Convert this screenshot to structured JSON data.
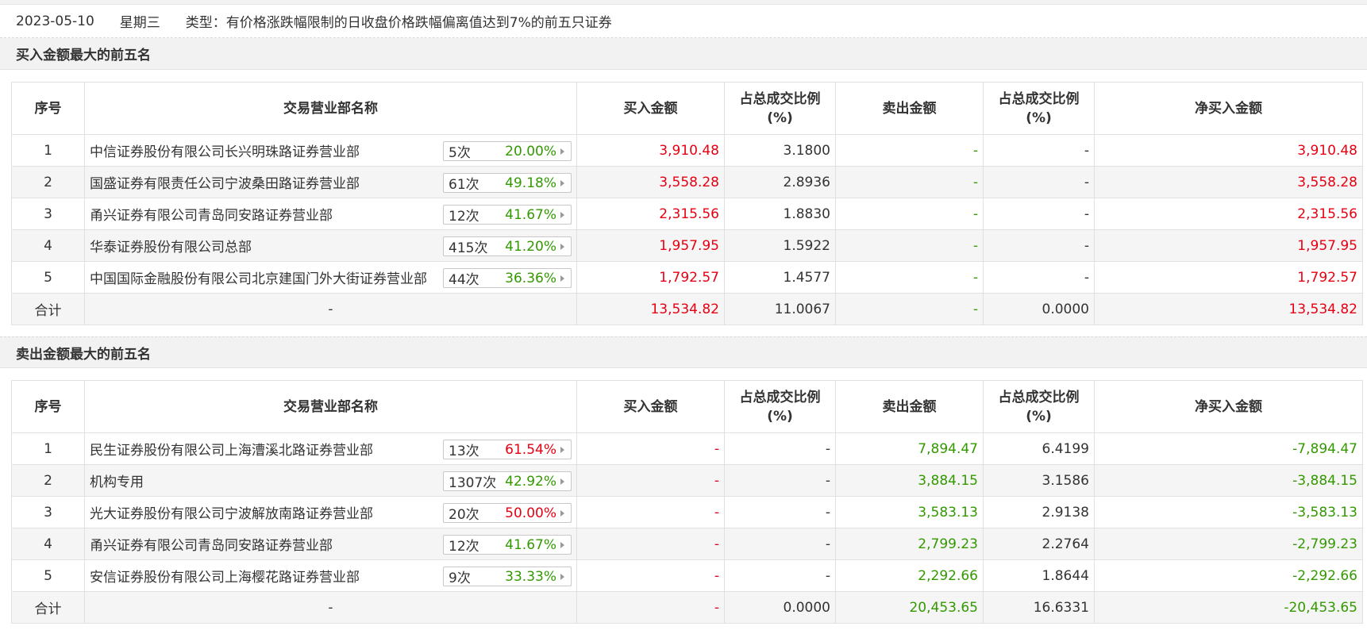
{
  "info": {
    "date": "2023-05-10",
    "weekday": "星期三",
    "type_text": "类型：有价格涨跌幅限制的日收盘价格跌幅偏离值达到7%的前五只证券"
  },
  "colors": {
    "up": "#e60012",
    "down": "#339900",
    "text": "#333333"
  },
  "headers": {
    "idx": "序号",
    "name": "交易营业部名称",
    "buy": "买入金额",
    "buy_ratio_l1": "占总成交比例",
    "buy_ratio_l2": "(%)",
    "sell": "卖出金额",
    "sell_ratio_l1": "占总成交比例",
    "sell_ratio_l2": "(%)",
    "net": "净买入金额"
  },
  "buy_section": {
    "title": "买入金额最大的前五名",
    "rows": [
      {
        "idx": "1",
        "name": "中信证券股份有限公司长兴明珠路证券营业部",
        "count": "5次",
        "rate": "20.00%",
        "rate_color": "green",
        "buy": "3,910.48",
        "buy_ratio": "3.1800",
        "sell": "-",
        "sell_ratio": "-",
        "net": "3,910.48"
      },
      {
        "idx": "2",
        "name": "国盛证券有限责任公司宁波桑田路证券营业部",
        "count": "61次",
        "rate": "49.18%",
        "rate_color": "green",
        "buy": "3,558.28",
        "buy_ratio": "2.8936",
        "sell": "-",
        "sell_ratio": "-",
        "net": "3,558.28"
      },
      {
        "idx": "3",
        "name": "甬兴证券有限公司青岛同安路证券营业部",
        "count": "12次",
        "rate": "41.67%",
        "rate_color": "green",
        "buy": "2,315.56",
        "buy_ratio": "1.8830",
        "sell": "-",
        "sell_ratio": "-",
        "net": "2,315.56"
      },
      {
        "idx": "4",
        "name": "华泰证券股份有限公司总部",
        "count": "415次",
        "rate": "41.20%",
        "rate_color": "green",
        "buy": "1,957.95",
        "buy_ratio": "1.5922",
        "sell": "-",
        "sell_ratio": "-",
        "net": "1,957.95"
      },
      {
        "idx": "5",
        "name": "中国国际金融股份有限公司北京建国门外大街证券营业部",
        "count": "44次",
        "rate": "36.36%",
        "rate_color": "green",
        "buy": "1,792.57",
        "buy_ratio": "1.4577",
        "sell": "-",
        "sell_ratio": "-",
        "net": "1,792.57"
      }
    ],
    "total": {
      "label": "合计",
      "name": "-",
      "buy": "13,534.82",
      "buy_ratio": "11.0067",
      "sell": "-",
      "sell_ratio": "0.0000",
      "net": "13,534.82"
    }
  },
  "sell_section": {
    "title": "卖出金额最大的前五名",
    "rows": [
      {
        "idx": "1",
        "name": "民生证券股份有限公司上海漕溪北路证券营业部",
        "count": "13次",
        "rate": "61.54%",
        "rate_color": "red",
        "buy": "-",
        "buy_ratio": "-",
        "sell": "7,894.47",
        "sell_ratio": "6.4199",
        "net": "-7,894.47"
      },
      {
        "idx": "2",
        "name": "机构专用",
        "count": "1307次",
        "rate": "42.92%",
        "rate_color": "green",
        "buy": "-",
        "buy_ratio": "-",
        "sell": "3,884.15",
        "sell_ratio": "3.1586",
        "net": "-3,884.15"
      },
      {
        "idx": "3",
        "name": "光大证券股份有限公司宁波解放南路证券营业部",
        "count": "20次",
        "rate": "50.00%",
        "rate_color": "red",
        "buy": "-",
        "buy_ratio": "-",
        "sell": "3,583.13",
        "sell_ratio": "2.9138",
        "net": "-3,583.13"
      },
      {
        "idx": "4",
        "name": "甬兴证券有限公司青岛同安路证券营业部",
        "count": "12次",
        "rate": "41.67%",
        "rate_color": "green",
        "buy": "-",
        "buy_ratio": "-",
        "sell": "2,799.23",
        "sell_ratio": "2.2764",
        "net": "-2,799.23"
      },
      {
        "idx": "5",
        "name": "安信证券股份有限公司上海樱花路证券营业部",
        "count": "9次",
        "rate": "33.33%",
        "rate_color": "green",
        "buy": "-",
        "buy_ratio": "-",
        "sell": "2,292.66",
        "sell_ratio": "1.8644",
        "net": "-2,292.66"
      }
    ],
    "total": {
      "label": "合计",
      "name": "-",
      "buy": "-",
      "buy_ratio": "0.0000",
      "sell": "20,453.65",
      "sell_ratio": "16.6331",
      "net": "-20,453.65"
    }
  }
}
